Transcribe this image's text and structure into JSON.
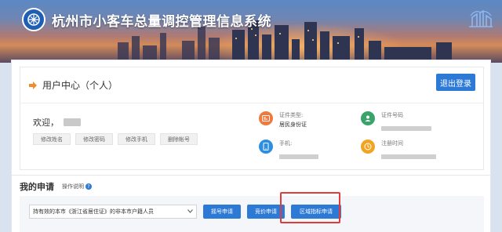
{
  "header": {
    "title": "杭州市小客车总量调控管理信息系统",
    "logo_icon": "logo-icon",
    "corner_mark_icon": "city-mark-icon"
  },
  "user_center": {
    "title": "用户中心（个人）",
    "logout_label": "退出登录",
    "welcome_prefix": "欢迎，",
    "actions": [
      "修改姓名",
      "修改密码",
      "修改手机",
      "删除帐号"
    ],
    "info": {
      "cert_type_label": "证件类型:",
      "cert_type_value": "居民身份证",
      "cert_no_label": "证件号码",
      "phone_label": "手机:",
      "register_time_label": "注册时间"
    }
  },
  "my_application": {
    "title": "我的申请",
    "help_label": "操作说明",
    "help_icon_text": "?",
    "selected_option": "持有效的本市《浙江省居住证》的非本市户籍人员",
    "buttons": {
      "lottery": "摇号申请",
      "bid": "竞价申请",
      "regional": "区域指标申请"
    }
  },
  "colors": {
    "accent": "#2d79d6",
    "highlight": "#e23b3b",
    "cert_icon": "#f07a3c",
    "id_icon": "#3aa36a",
    "phone_icon": "#2d8fe0",
    "time_icon": "#f2a322"
  }
}
